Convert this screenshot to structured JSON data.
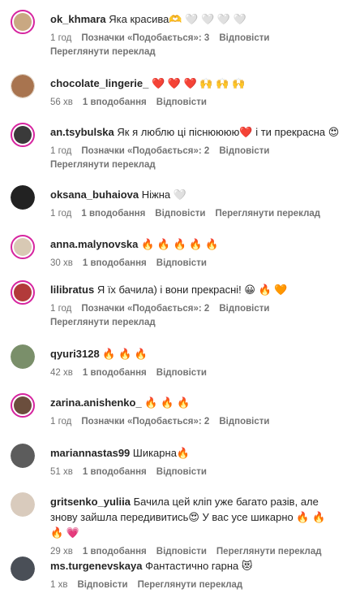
{
  "comments": [
    {
      "username": "ok_khmara",
      "text": "Яка красива🫶 🤍 🤍 🤍 🤍",
      "time": "1 год",
      "likes": "Позначки «Подобається»: 3",
      "reply": "Відповісти",
      "translation": "Переглянути переклад",
      "avatar_color": "#c9a882",
      "ring": true
    },
    {
      "username": "chocolate_lingerie_",
      "text": "❤️ ❤️ ❤️ 🙌 🙌 🙌",
      "time": "56 хв",
      "likes": "1 вподобання",
      "reply": "Відповісти",
      "avatar_color": "#a8744f",
      "ring": false
    },
    {
      "username": "an.tsybulska",
      "text": "Як я люблю ці піснюююю❤️ і ти прекрасна 😍",
      "time": "1 год",
      "likes": "Позначки «Подобається»: 2",
      "reply": "Відповісти",
      "translation": "Переглянути переклад",
      "avatar_color": "#3a3a3a",
      "ring": true
    },
    {
      "username": "oksana_buhaiova",
      "text": "Ніжна 🤍",
      "time": "1 год",
      "likes": "1 вподобання",
      "reply": "Відповісти",
      "translation": "Переглянути переклад",
      "avatar_color": "#222222",
      "ring": false
    },
    {
      "username": "anna.malynovska",
      "text": "🔥 🔥 🔥 🔥 🔥",
      "time": "30 хв",
      "likes": "1 вподобання",
      "reply": "Відповісти",
      "avatar_color": "#d8c9b4",
      "ring": true
    },
    {
      "username": "lilibratus",
      "text": "Я їх бачила) і вони прекрасні! 😀 🔥 🧡",
      "time": "1 год",
      "likes": "Позначки «Подобається»: 2",
      "reply": "Відповісти",
      "translation": "Переглянути переклад",
      "avatar_color": "#b23a3a",
      "ring": true
    },
    {
      "username": "qyuri3128",
      "text": "🔥 🔥 🔥",
      "time": "42 хв",
      "likes": "1 вподобання",
      "reply": "Відповісти",
      "avatar_color": "#7a8f6a",
      "ring": false
    },
    {
      "username": "zarina.anishenko_",
      "text": "🔥 🔥 🔥",
      "time": "1 год",
      "likes": "Позначки «Подобається»: 2",
      "reply": "Відповісти",
      "avatar_color": "#6b4e3d",
      "ring": true
    },
    {
      "username": "mariannastas99",
      "text": "Шикарна🔥",
      "time": "51 хв",
      "likes": "1 вподобання",
      "reply": "Відповісти",
      "avatar_color": "#5c5c5c",
      "ring": false
    },
    {
      "username": "gritsenko_yuliia",
      "text": "Бачила цей кліп уже багато разів, але знову зайшла передивитись😍 У вас усе шикарно 🔥 🔥 🔥 💗",
      "time": "29 хв",
      "likes": "1 вподобання",
      "reply": "Відповісти",
      "translation": "Переглянути переклад",
      "avatar_color": "#d9cbbd",
      "ring": false
    },
    {
      "username": "ms.turgenevskaya",
      "text": "Фантастично гарна 😻",
      "time": "1 хв",
      "reply": "Відповісти",
      "translation": "Переглянути переклад",
      "avatar_color": "#4a4f57",
      "ring": false
    }
  ]
}
